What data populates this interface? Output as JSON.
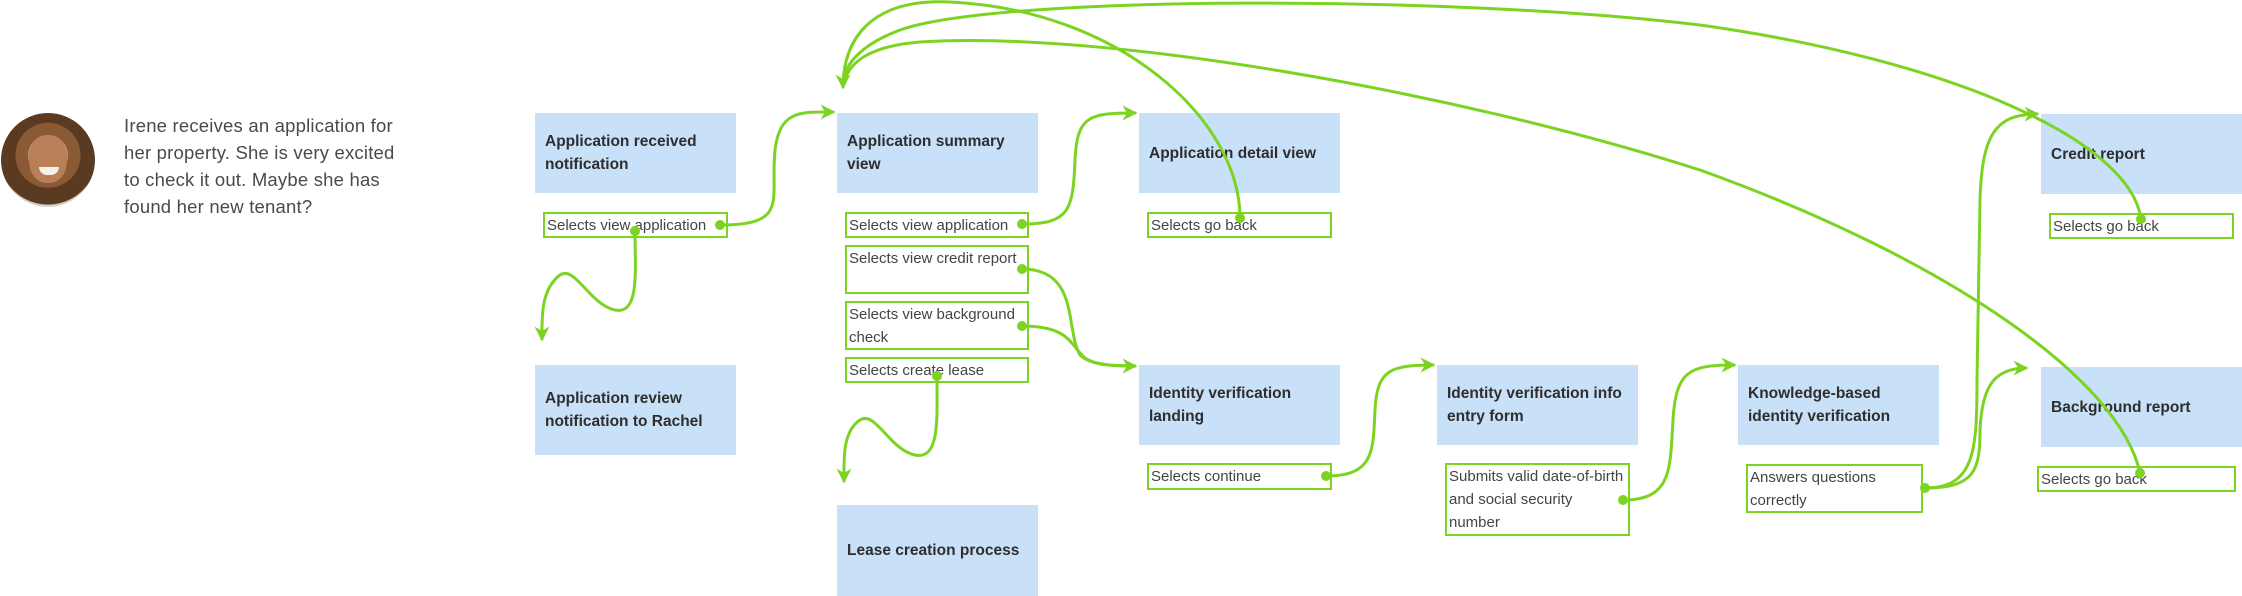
{
  "persona": {
    "avatar": "smiling-woman-photo",
    "description": "Irene receives an application for her property. She is very excited to check it out. Maybe she has found her new tenant?"
  },
  "screens": [
    {
      "id": "app-received",
      "label": "Application received notification"
    },
    {
      "id": "app-review-rachel",
      "label": "Application review notification to Rachel"
    },
    {
      "id": "app-summary",
      "label": "Application summary view"
    },
    {
      "id": "lease-creation",
      "label": "Lease creation process"
    },
    {
      "id": "app-detail",
      "label": "Application detail view"
    },
    {
      "id": "id-landing",
      "label": "Identity verification landing"
    },
    {
      "id": "id-entry",
      "label": "Identity verification info entry form"
    },
    {
      "id": "kba",
      "label": "Knowledge-based identity verification"
    },
    {
      "id": "credit-report",
      "label": "Credit report"
    },
    {
      "id": "background-report",
      "label": "Background report"
    }
  ],
  "actions": [
    {
      "screen": "app-received",
      "label": "Selects view application"
    },
    {
      "screen": "app-summary",
      "label": "Selects view application"
    },
    {
      "screen": "app-summary",
      "label": "Selects view credit report"
    },
    {
      "screen": "app-summary",
      "label": "Selects view background check"
    },
    {
      "screen": "app-summary",
      "label": "Selects create lease"
    },
    {
      "screen": "app-detail",
      "label": "Selects go back"
    },
    {
      "screen": "id-landing",
      "label": "Selects continue"
    },
    {
      "screen": "id-entry",
      "label": "Submits valid date-of-birth and social security number"
    },
    {
      "screen": "kba",
      "label": "Answers questions correctly"
    },
    {
      "screen": "credit-report",
      "label": "Selects go back"
    },
    {
      "screen": "background-report",
      "label": "Selects go back"
    }
  ],
  "flows": [
    {
      "from": "app-received / Selects view application",
      "to": "app-summary"
    },
    {
      "from": "app-received / Selects view application",
      "to": "app-review-rachel"
    },
    {
      "from": "app-summary / Selects view application",
      "to": "app-detail"
    },
    {
      "from": "app-summary / Selects view credit report",
      "to": "id-landing"
    },
    {
      "from": "app-summary / Selects view background check",
      "to": "id-landing"
    },
    {
      "from": "app-summary / Selects create lease",
      "to": "lease-creation"
    },
    {
      "from": "app-detail / Selects go back",
      "to": "app-summary"
    },
    {
      "from": "id-landing / Selects continue",
      "to": "id-entry"
    },
    {
      "from": "id-entry / Submits valid date-of-birth and social security number",
      "to": "kba"
    },
    {
      "from": "kba / Answers questions correctly",
      "to": "credit-report"
    },
    {
      "from": "kba / Answers questions correctly",
      "to": "background-report"
    },
    {
      "from": "credit-report / Selects go back",
      "to": "app-summary"
    },
    {
      "from": "background-report / Selects go back",
      "to": "app-summary"
    }
  ],
  "colors": {
    "screen_fill": "#c8e0f8",
    "connector": "#7dd321",
    "text": "#333333"
  }
}
